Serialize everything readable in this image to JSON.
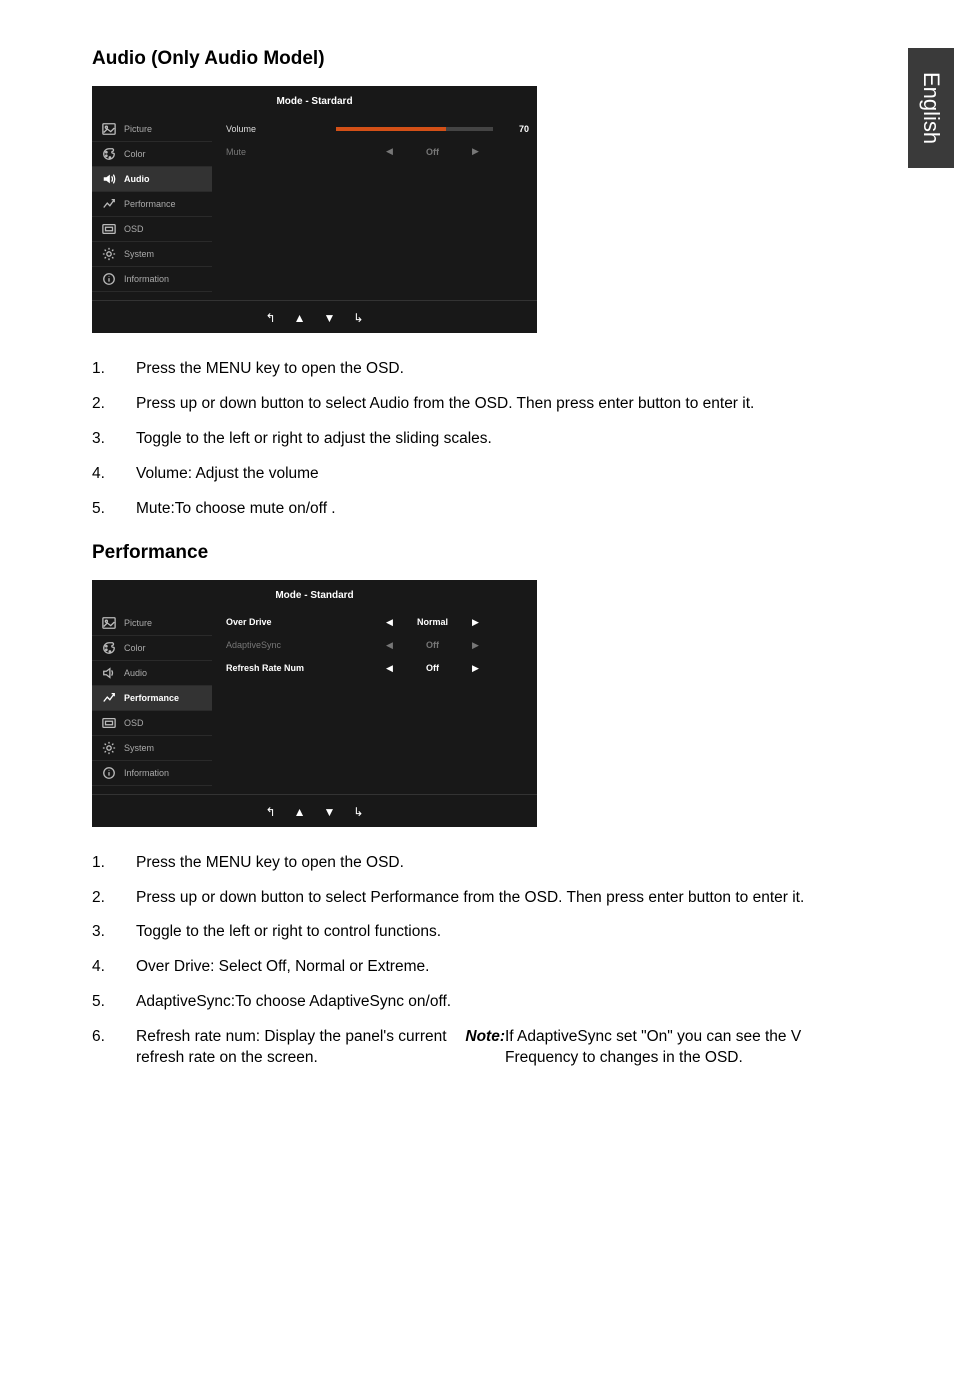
{
  "language_tab": "English",
  "section1": {
    "heading": "Audio (Only Audio Model)",
    "osd": {
      "mode_label": "Mode - Stardard",
      "menu": {
        "picture": "Picture",
        "color": "Color",
        "audio": "Audio",
        "performance": "Performance",
        "osd": "OSD",
        "system": "System",
        "information": "Information"
      },
      "rows": {
        "volume_label": "Volume",
        "volume_value": "70",
        "mute_label": "Mute",
        "mute_value": "Off"
      }
    },
    "steps": [
      "Press the MENU key to open the OSD.",
      "Press up or down button to select Audio from the OSD. Then press enter button to enter it.",
      "Toggle to the left or right to adjust the sliding scales.",
      "Volume: Adjust the volume",
      "Mute:To choose mute on/off ."
    ]
  },
  "section2": {
    "heading": "Performance",
    "osd": {
      "mode_label": "Mode - Standard",
      "menu": {
        "picture": "Picture",
        "color": "Color",
        "audio": "Audio",
        "performance": "Performance",
        "osd": "OSD",
        "system": "System",
        "information": "Information"
      },
      "rows": {
        "overdrive_label": "Over Drive",
        "overdrive_value": "Normal",
        "adaptivesync_label": "AdaptiveSync",
        "adaptivesync_value": "Off",
        "refresh_label": "Refresh Rate Num",
        "refresh_value": "Off"
      }
    },
    "steps": [
      "Press the MENU key to open the OSD.",
      "Press up or down button to select Performance from the OSD. Then press enter button to enter it.",
      "Toggle to the left or right to control functions.",
      "Over Drive: Select Off, Normal or Extreme.",
      "AdaptiveSync:To choose AdaptiveSync on/off.",
      "Refresh rate num: Display the panel's current refresh rate on the screen."
    ],
    "note_label": "Note:",
    "note_text": " If AdaptiveSync set \"On\" you can see the V Frequency to changes in the OSD."
  },
  "slider_fill_percent": "70%"
}
